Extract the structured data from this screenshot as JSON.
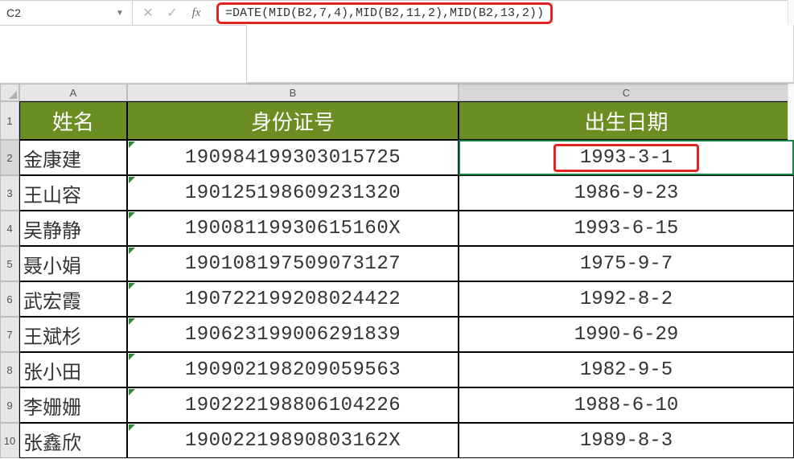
{
  "namebox": {
    "value": "C2"
  },
  "formula_bar": {
    "cancel_icon": "✕",
    "enter_icon": "✓",
    "fx_label": "fx",
    "formula": "=DATE(MID(B2,7,4),MID(B2,11,2),MID(B2,13,2))"
  },
  "columns": [
    "A",
    "B",
    "C"
  ],
  "headers": {
    "A": "姓名",
    "B": "身份证号",
    "C": "出生日期"
  },
  "active_cell": "C2",
  "rows": [
    {
      "n": 1
    },
    {
      "n": 2,
      "A": "金康建",
      "B": "190984199303015725",
      "C": "1993-3-1"
    },
    {
      "n": 3,
      "A": "王山容",
      "B": "190125198609231320",
      "C": "1986-9-23"
    },
    {
      "n": 4,
      "A": "吴静静",
      "B": "19008119930615160X",
      "C": "1993-6-15"
    },
    {
      "n": 5,
      "A": "聂小娟",
      "B": "190108197509073127",
      "C": "1975-9-7"
    },
    {
      "n": 6,
      "A": "武宏霞",
      "B": "190722199208024422",
      "C": "1992-8-2"
    },
    {
      "n": 7,
      "A": "王斌杉",
      "B": "190623199006291839",
      "C": "1990-6-29"
    },
    {
      "n": 8,
      "A": "张小田",
      "B": "190902198209059563",
      "C": "1982-9-5"
    },
    {
      "n": 9,
      "A": "李姗姗",
      "B": "190222198806104226",
      "C": "1988-6-10"
    },
    {
      "n": 10,
      "A": "张鑫欣",
      "B": "19002219890803162X",
      "C": "1989-8-3"
    }
  ]
}
